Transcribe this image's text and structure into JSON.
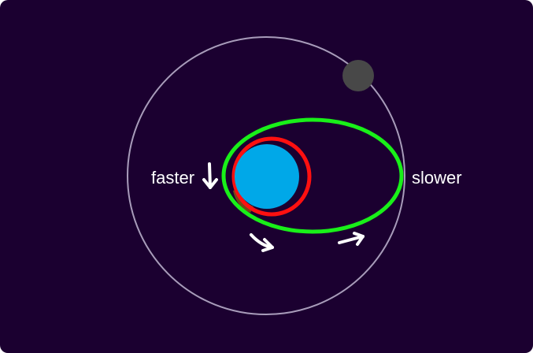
{
  "diagram": {
    "labels": {
      "faster": "faster",
      "slower": "slower"
    },
    "colors": {
      "background": "#1b0030",
      "outer_orbit": "#a89cba",
      "moon": "#484848",
      "planet": "#00a8e8",
      "circular_orbit": "#ff1010",
      "elliptical_orbit": "#19f019",
      "arrows": "#ffffff",
      "text": "#ffffff"
    }
  }
}
